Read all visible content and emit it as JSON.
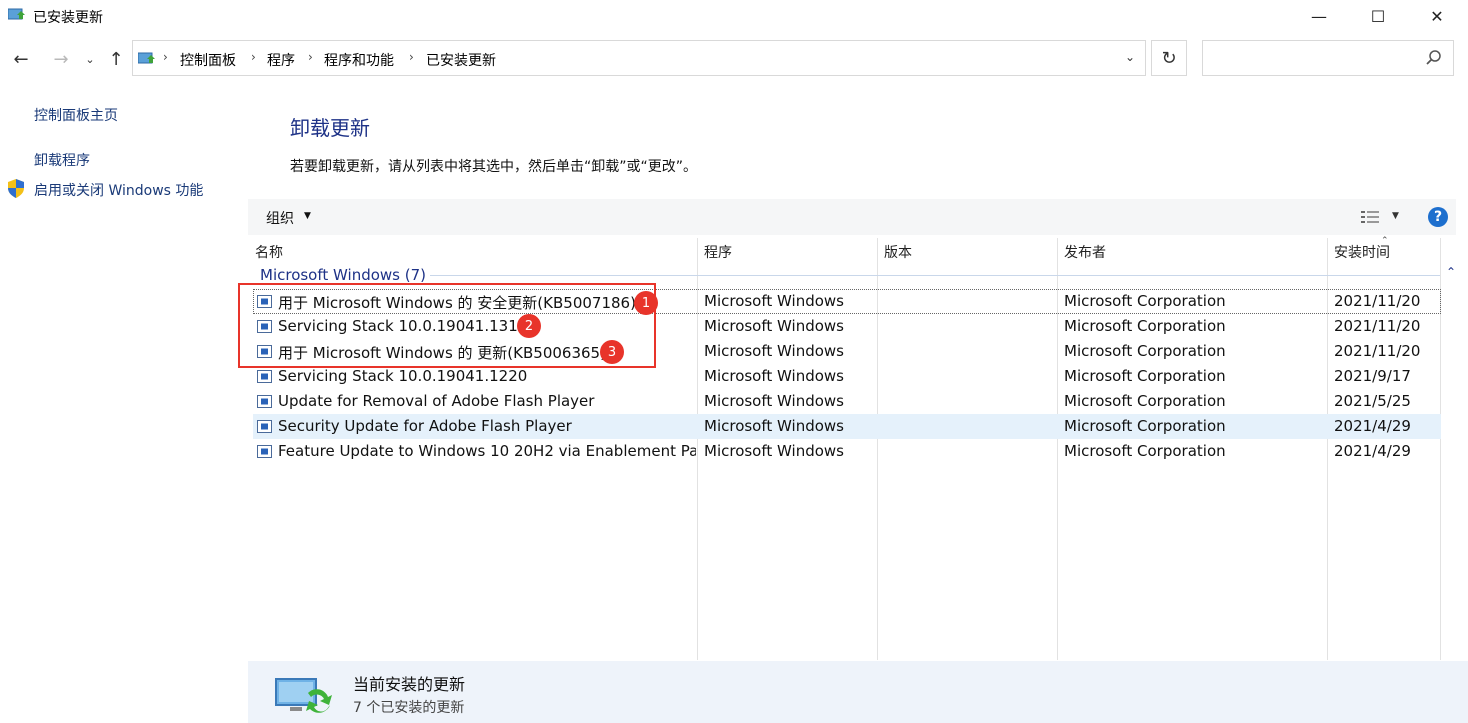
{
  "window": {
    "title": "已安装更新"
  },
  "controls": {
    "minimize": "—",
    "maximize": "☐",
    "close": "✕"
  },
  "nav": {
    "back": "←",
    "forward": "→",
    "recent": "⌄",
    "up": "↑",
    "refresh": "↻",
    "address_dropdown": "⌄"
  },
  "breadcrumb": [
    "控制面板",
    "程序",
    "程序和功能",
    "已安装更新"
  ],
  "breadcrumb_sep": "›",
  "search": {
    "placeholder": ""
  },
  "sidebar": {
    "home": "控制面板主页",
    "uninstall": "卸载程序",
    "features": "启用或关闭 Windows 功能"
  },
  "main": {
    "title": "卸载更新",
    "description": "若要卸载更新，请从列表中将其选中，然后单击“卸载”或“更改”。"
  },
  "toolbar": {
    "organize": "组织",
    "organize_caret": "▼",
    "view_caret": "▼",
    "help": "?"
  },
  "columns": {
    "name": "名称",
    "program": "程序",
    "version": "版本",
    "publisher": "发布者",
    "date": "安装时间",
    "sort_caret": "⌃"
  },
  "group": {
    "label": "Microsoft Windows (7)",
    "collapse": "⌃"
  },
  "rows": [
    {
      "name": "用于 Microsoft Windows 的 安全更新(KB5007186)",
      "program": "Microsoft Windows",
      "version": "",
      "publisher": "Microsoft Corporation",
      "date": "2021/11/20"
    },
    {
      "name": "Servicing Stack 10.0.19041.1310",
      "program": "Microsoft Windows",
      "version": "",
      "publisher": "Microsoft Corporation",
      "date": "2021/11/20"
    },
    {
      "name": "用于 Microsoft Windows 的 更新(KB5006365)",
      "program": "Microsoft Windows",
      "version": "",
      "publisher": "Microsoft Corporation",
      "date": "2021/11/20"
    },
    {
      "name": "Servicing Stack 10.0.19041.1220",
      "program": "Microsoft Windows",
      "version": "",
      "publisher": "Microsoft Corporation",
      "date": "2021/9/17"
    },
    {
      "name": "Update for Removal of Adobe Flash Player",
      "program": "Microsoft Windows",
      "version": "",
      "publisher": "Microsoft Corporation",
      "date": "2021/5/25"
    },
    {
      "name": "Security Update for Adobe Flash Player",
      "program": "Microsoft Windows",
      "version": "",
      "publisher": "Microsoft Corporation",
      "date": "2021/4/29"
    },
    {
      "name": "Feature Update to Windows 10 20H2 via Enablement Pa...",
      "program": "Microsoft Windows",
      "version": "",
      "publisher": "Microsoft Corporation",
      "date": "2021/4/29"
    }
  ],
  "annotations": [
    "1",
    "2",
    "3"
  ],
  "details": {
    "title": "当前安装的更新",
    "subtitle": "7 个已安装的更新"
  },
  "colors": {
    "accent": "#1e3287",
    "selection": "#e5f1fb",
    "annotation": "#e8342a",
    "help": "#1d6fce"
  }
}
